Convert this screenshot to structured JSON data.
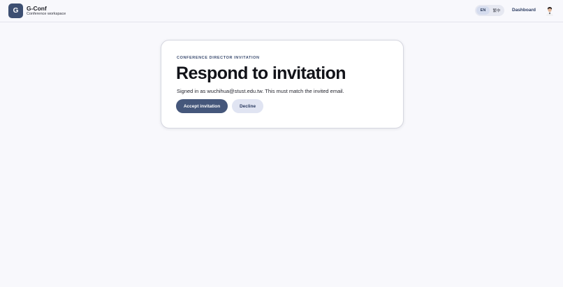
{
  "header": {
    "logo_letter": "G",
    "brand_name": "G-Conf",
    "brand_subtitle": "Conference workspace",
    "languages": [
      "EN",
      "繁中"
    ],
    "active_language": "EN",
    "dashboard_label": "Dashboard",
    "avatar_icon": "user-avatar-icon"
  },
  "card": {
    "eyebrow": "CONFERENCE DIRECTOR INVITATION",
    "title": "Respond to invitation",
    "signed_in_text": "Signed in as wuchihua@stust.edu.tw. This must match the invited email.",
    "accept_label": "Accept invitation",
    "decline_label": "Decline"
  },
  "colors": {
    "primary": "#45577b",
    "secondary": "#e0e4f2",
    "background": "#f8f8fc"
  }
}
